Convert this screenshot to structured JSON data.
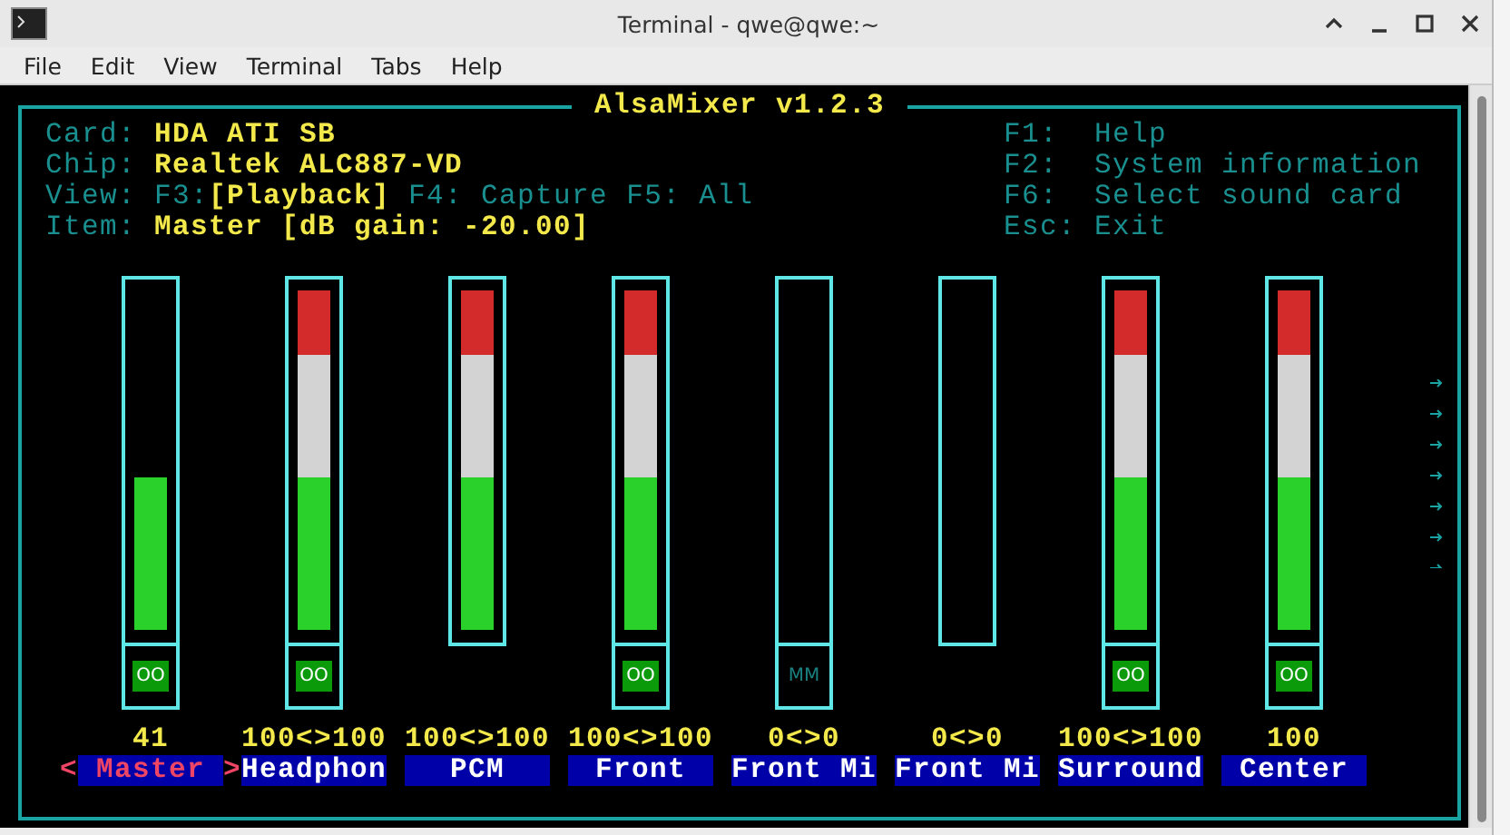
{
  "window": {
    "title": "Terminal - qwe@qwe:~"
  },
  "menu": [
    "File",
    "Edit",
    "View",
    "Terminal",
    "Tabs",
    "Help"
  ],
  "mixer": {
    "title": "AlsaMixer v1.2.3",
    "info": [
      {
        "label": "Card:",
        "value": "HDA ATI SB"
      },
      {
        "label": "Chip:",
        "value": "Realtek ALC887-VD"
      },
      {
        "label": "View:",
        "parts": [
          {
            "text": "F3:",
            "selected": false
          },
          {
            "text": "[Playback]",
            "selected": true
          },
          {
            "text": "F4: Capture",
            "selected": false
          },
          {
            "text": "F5: All",
            "selected": false
          }
        ]
      },
      {
        "label": "Item:",
        "value": "Master [dB gain: -20.00]"
      }
    ],
    "keys": [
      {
        "key": "F1:",
        "action": "Help"
      },
      {
        "key": "F2:",
        "action": "System information"
      },
      {
        "key": "F6:",
        "action": "Select sound card"
      },
      {
        "key": "Esc:",
        "action": "Exit"
      }
    ],
    "selection_arrows": {
      "left": "<",
      "right": ">"
    },
    "channels": [
      {
        "name": "Master",
        "selected": true,
        "level": 0.45,
        "value": "41",
        "switch": {
          "text": "OO",
          "muted": false
        }
      },
      {
        "name": "Headphon",
        "selected": false,
        "level": 1,
        "value": "100<>100",
        "switch": {
          "text": "OO",
          "muted": false
        }
      },
      {
        "name": "PCM",
        "selected": false,
        "level": 1,
        "value": "100<>100"
      },
      {
        "name": "Front",
        "selected": false,
        "level": 1,
        "value": "100<>100",
        "switch": {
          "text": "OO",
          "muted": false
        }
      },
      {
        "name": "Front Mi",
        "selected": false,
        "value": "0<>0",
        "switch": {
          "text": "MM",
          "muted": true
        }
      },
      {
        "name": "Front Mi",
        "selected": false,
        "value": "0<>0"
      },
      {
        "name": "Surround",
        "selected": false,
        "level": 1,
        "value": "100<>100",
        "switch": {
          "text": "OO",
          "muted": false
        }
      },
      {
        "name": "Center",
        "selected": false,
        "level": 1,
        "value": "100",
        "switch": {
          "text": "OO",
          "muted": false
        }
      }
    ]
  }
}
